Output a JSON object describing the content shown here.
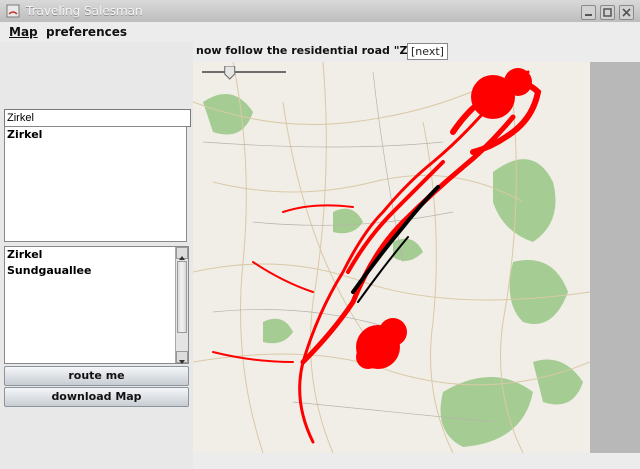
{
  "window": {
    "title": "Traveling Salesman",
    "controls": [
      "minimize-icon",
      "maximize-icon",
      "close-icon"
    ]
  },
  "menu": {
    "items": [
      {
        "label": "Map"
      },
      {
        "label": "preferences"
      }
    ]
  },
  "navigation": {
    "instruction": "now follow the residential road \"Zirkel\"",
    "next_label": "[next]"
  },
  "search": {
    "value": "Zirkel",
    "results": [
      "Zirkel"
    ]
  },
  "route": {
    "stops": [
      "Zirkel",
      "Sundgauallee"
    ]
  },
  "buttons": {
    "route_label": "route me",
    "download_label": "download Map"
  },
  "map": {
    "zoom_fraction": 0.33,
    "route_color": "#ff0000",
    "path_color": "#000000"
  }
}
